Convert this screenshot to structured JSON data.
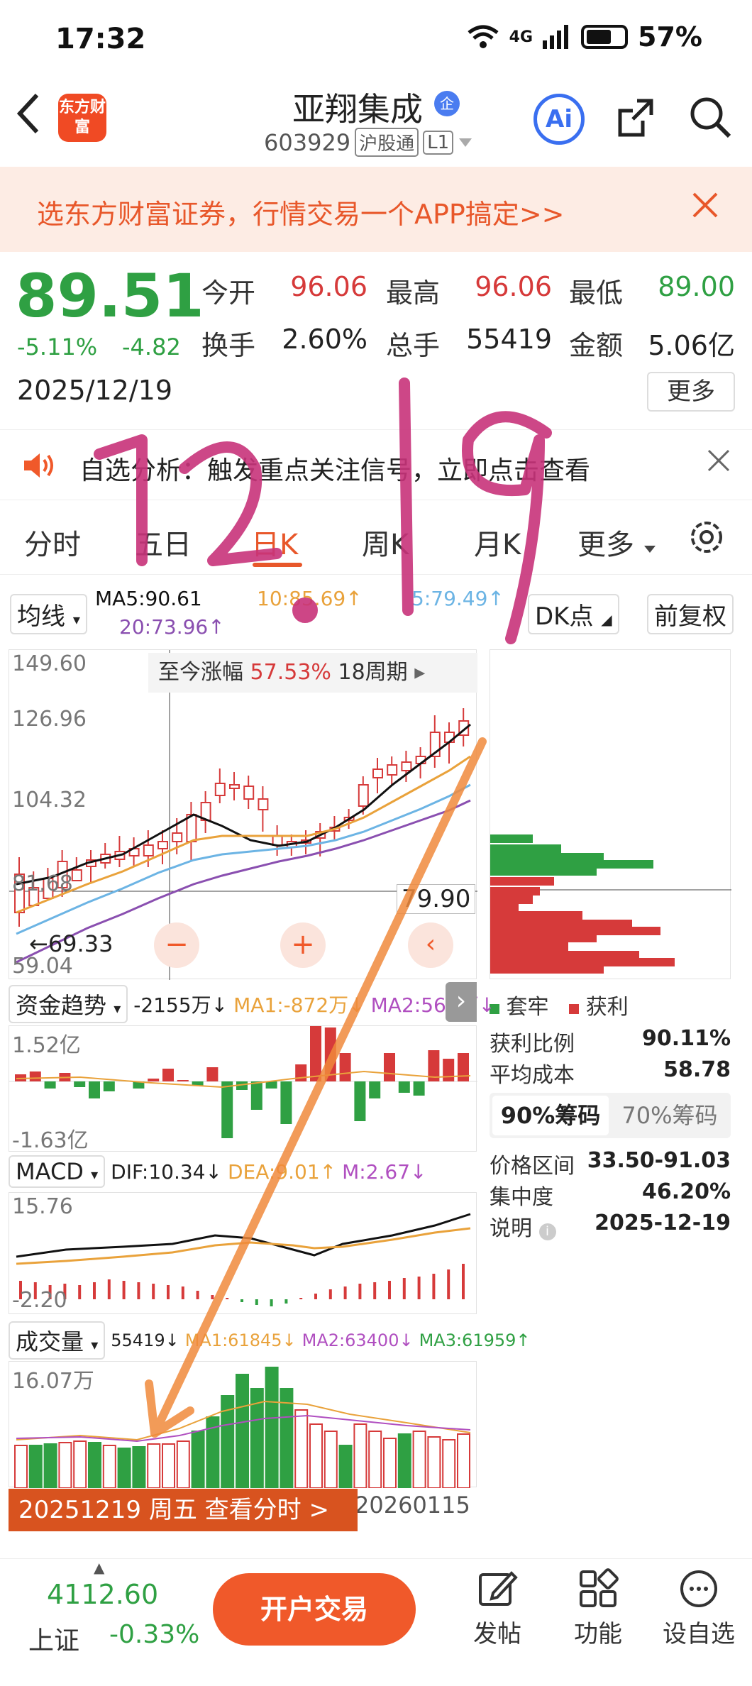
{
  "status_bar": {
    "time": "17:32",
    "network": "4G",
    "battery": "57%"
  },
  "header": {
    "back_icon": "chevron-left-icon",
    "logo_text": "东方财富",
    "stock_name": "亚翔集成",
    "badge": "企",
    "stock_code": "603929",
    "tag1": "沪股通",
    "tag2": "L1",
    "ai_label": "Ai"
  },
  "promo": {
    "text": "选东方财富证券，行情交易一个APP搞定>>"
  },
  "quote": {
    "price": "89.51",
    "change_pct": "-5.11%",
    "change_abs": "-4.82",
    "date": "2025/12/19",
    "open_label": "今开",
    "open_value": "96.06",
    "high_label": "最高",
    "high_value": "96.06",
    "low_label": "最低",
    "low_value": "89.00",
    "turnover_label": "换手",
    "turnover_value": "2.60%",
    "volume_label": "总手",
    "volume_value": "55419",
    "amount_label": "金额",
    "amount_value": "5.06亿",
    "more_label": "更多"
  },
  "notice": {
    "text": "自选分析：触发重点关注信号，立即点击查看"
  },
  "tabs": [
    "分时",
    "五日",
    "日K",
    "周K",
    "月K",
    "更多"
  ],
  "active_tab": "日K",
  "indicators": {
    "ma_select": "均线",
    "ma5": "MA5:90.61",
    "ma10": "10:85.69↑",
    "ma30": "5:79.49↑",
    "ma20": "20:73.96↑",
    "dk_select": "DK点",
    "adjust_select": "前复权"
  },
  "kline": {
    "y_top": "149.60",
    "y_mid1": "126.96",
    "y_mid2": "104.32",
    "y_mid3": "81.68",
    "y_bottom": "59.04",
    "stat_label": "至今涨幅",
    "stat_value": "57.53%",
    "stat_period": "18周期",
    "min_marker": "←69.33",
    "cursor_price": "79.90",
    "annotation": "12.19"
  },
  "fund": {
    "select": "资金趋势",
    "value": "-2155万↓",
    "ma1": "MA1:-872万↓",
    "ma2": "MA2:569万↓",
    "y_top": "1.52亿",
    "y_bottom": "-1.63亿"
  },
  "macd": {
    "select": "MACD",
    "dif": "DIF:10.34↓",
    "dea": "DEA:9.01↑",
    "m": "M:2.67↓",
    "y_top": "15.76",
    "y_bottom": "-2.20"
  },
  "volume": {
    "select": "成交量",
    "value": "55419↓",
    "ma1": "MA1:61845↓",
    "ma2": "MA2:63400↓",
    "ma3": "MA3:61959↑",
    "y_top": "16.07万",
    "x_end": "20260115"
  },
  "tooltip": {
    "text": "20251219 周五 查看分时 >"
  },
  "distribution": {
    "legend_trapped": "套牢",
    "legend_profit": "获利",
    "profit_ratio_label": "获利比例",
    "profit_ratio_value": "90.11%",
    "avg_cost_label": "平均成本",
    "avg_cost_value": "58.78",
    "tab_90": "90%筹码",
    "tab_70": "70%筹码",
    "range_label": "价格区间",
    "range_value": "33.50-91.03",
    "concentration_label": "集中度",
    "concentration_value": "46.20%",
    "note_label": "说明",
    "note_value": "2025-12-19"
  },
  "bottom": {
    "index_value": "4112.60",
    "index_name": "上证",
    "index_change": "-0.33%",
    "open_account": "开户交易",
    "nav_post": "发帖",
    "nav_function": "功能",
    "nav_watchlist": "设自选"
  },
  "colors": {
    "up": "#d63a3a",
    "down": "#2fa043",
    "accent": "#e8572a",
    "ma5": "#111111",
    "ma10": "#e9a23b",
    "ma20": "#8a4fb0",
    "ma30": "#6cb4e4"
  }
}
